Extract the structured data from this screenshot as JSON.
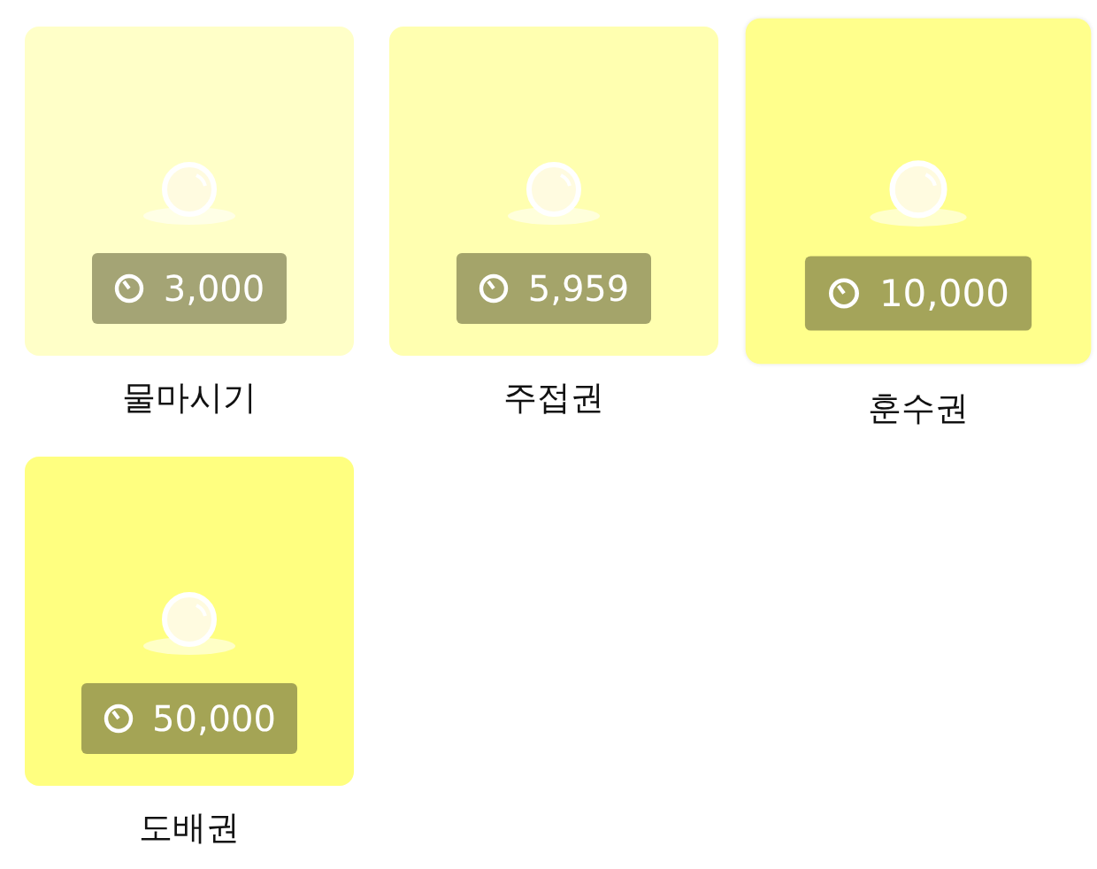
{
  "items": [
    {
      "name": "물마시기",
      "price": "3,000",
      "color": "#ffffc8",
      "selected": false
    },
    {
      "name": "주접권",
      "price": "5,959",
      "color": "#ffffb0",
      "selected": false
    },
    {
      "name": "훈수권",
      "price": "10,000",
      "color": "#ffff8c",
      "selected": true
    },
    {
      "name": "도배권",
      "price": "50,000",
      "color": "#ffff80",
      "selected": false
    }
  ]
}
